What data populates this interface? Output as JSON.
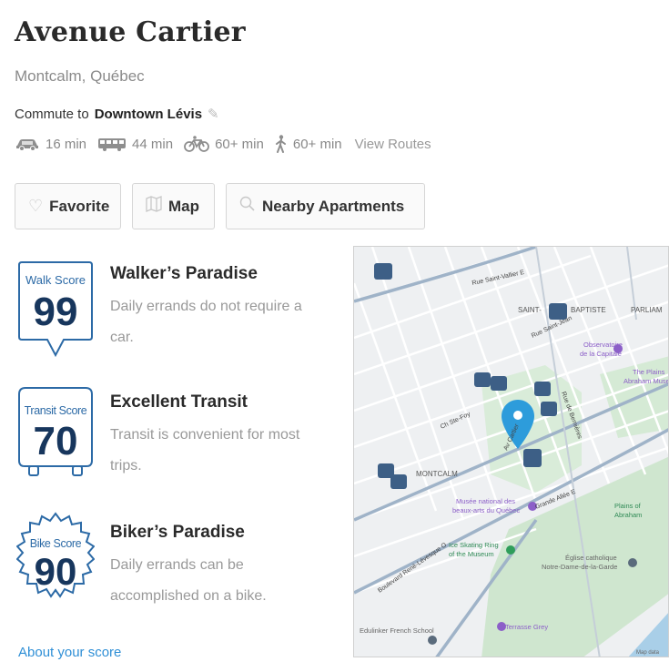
{
  "listing": {
    "title": "Avenue Cartier",
    "subtitle": "Montcalm, Québec"
  },
  "commute": {
    "prefix": "Commute to",
    "destination": "Downtown Lévis",
    "edit_icon": "pencil-icon",
    "modes": [
      {
        "icon": "car-icon",
        "time": "16 min"
      },
      {
        "icon": "bus-icon",
        "time": "44 min"
      },
      {
        "icon": "bike-icon",
        "time": "60+ min"
      },
      {
        "icon": "walk-icon",
        "time": "60+ min"
      }
    ],
    "view_routes": "View Routes"
  },
  "buttons": {
    "favorite": {
      "label": "Favorite",
      "icon": "heart-outline-icon"
    },
    "map": {
      "label": "Map",
      "icon": "map-icon"
    },
    "nearby": {
      "label": "Nearby Apartments",
      "icon": "search-icon"
    }
  },
  "scores": [
    {
      "badge_label": "Walk Score",
      "value": "99",
      "title": "Walker’s Paradise",
      "desc_line1": "Daily errands do not require a",
      "desc_line2": "car."
    },
    {
      "badge_label": "Transit Score",
      "value": "70",
      "title": "Excellent Transit",
      "desc_line1": "Transit is convenient for most",
      "desc_line2": "trips."
    },
    {
      "badge_label": "Bike Score",
      "value": "90",
      "title": "Biker’s Paradise",
      "desc_line1": "Daily errands can be",
      "desc_line2": "accomplished on a bike."
    }
  ],
  "about_link": "About your score",
  "map": {
    "labels": {
      "saint_baptiste_a": "SAINT-",
      "saint_baptiste_b": "BAPTISTE",
      "parliament": "PARLIAM",
      "observatoire_a": "Observatoire",
      "observatoire_b": "de la Capitale",
      "plains_top_a": "The Plains",
      "plains_top_b": "Abraham Museu",
      "montcalm": "MONTCALM",
      "musee_a": "Musée national des",
      "musee_b": "beaux-arts du Québec",
      "plains_a": "Plains of",
      "plains_b": "Abraham",
      "ice_a": "Ice Skating Ring",
      "ice_b": "of the Museum",
      "eglise_a": "Église catholique",
      "eglise_b": "Notre-Dame-de-la-Garde",
      "school": "Edulinker French School",
      "terrasse": "Terrasse Grey",
      "rue_saint_jean": "Rue Saint-Jean",
      "ch_ste_foy": "Ch Ste-Foy",
      "blvd_rene": "Boulevard René-Lévesque O",
      "grande_allee": "Grande Allée E",
      "rue_st_vallier": "Rue Saint-Vallier E",
      "ave_cartier": "Av Cartier",
      "rue_de_bernieres": "Rue de Bernières",
      "map_data": "Map data"
    },
    "colors": {
      "water": "#a9cfe8",
      "park": "#cfe6cf",
      "land": "#eef0f2",
      "road": "#ffffff",
      "major_road": "#9fb3c8",
      "pin": "#2d9cdb"
    }
  },
  "colors": {
    "badge_blue": "#2c6aa6",
    "badge_text": "#17365d",
    "link": "#2f8fd6"
  }
}
